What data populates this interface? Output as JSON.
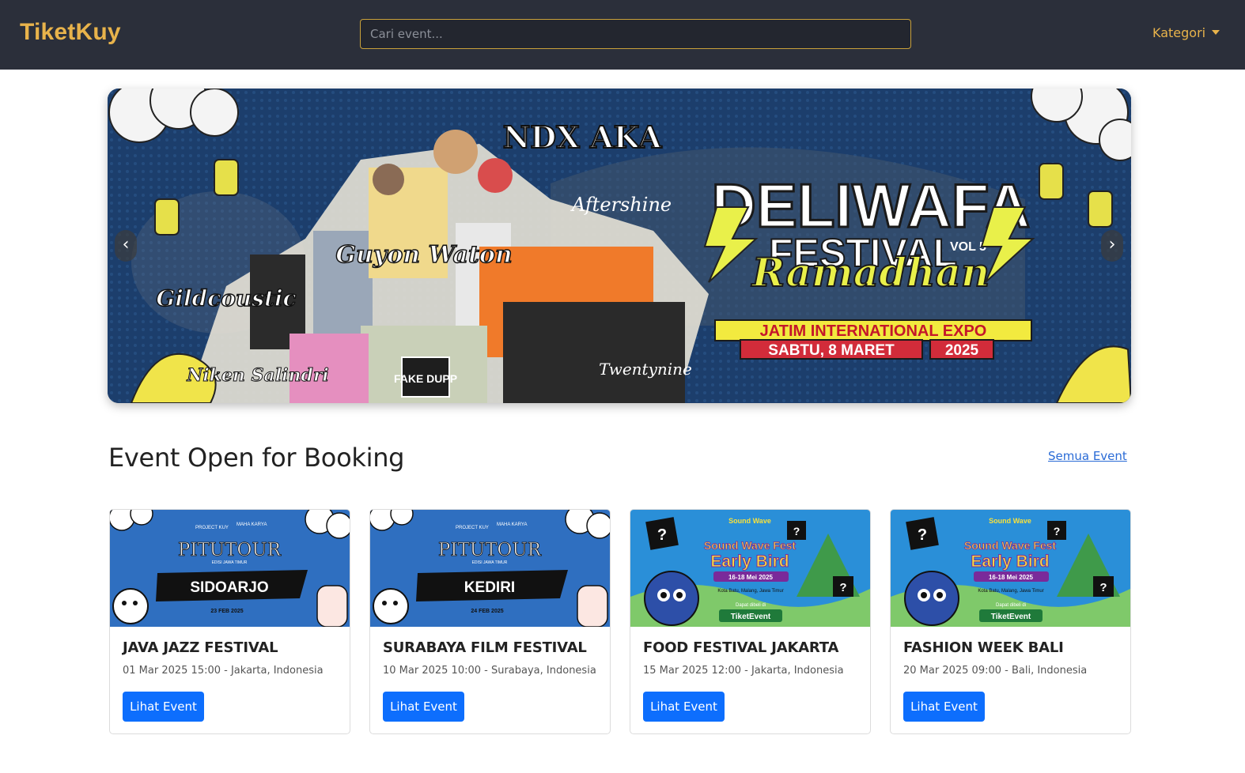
{
  "navbar": {
    "brand": "TiketKuy",
    "search_placeholder": "Cari event...",
    "category_label": "Kategori"
  },
  "carousel": {
    "banner": {
      "headline_1": "DELIWAFA",
      "headline_2": "FESTIVAL",
      "volume": "VOL 5",
      "subtitle": "Ramadhan",
      "venue": "JATIM INTERNATIONAL EXPO",
      "date": "SABTU, 8 MARET",
      "year": "2025",
      "lineup": [
        "NDX AKA",
        "Aftershine",
        "Guyon Waton",
        "Gildcoustic",
        "Niken Salindri",
        "FAKE DUPP",
        "Twentynine"
      ]
    },
    "prev_symbol": "‹",
    "next_symbol": "›"
  },
  "section": {
    "title": "Event Open for Booking",
    "all_link": "Semua Event"
  },
  "events": [
    {
      "title": "JAVA JAZZ FESTIVAL",
      "meta": "01 Mar 2025 15:00 - Jakarta, Indonesia",
      "button": "Lihat Event",
      "poster": {
        "headline": "PITUTOUR",
        "tagline": "EDISI JAWA TIMUR",
        "city": "SIDOARJO",
        "date": "23 FEB 2025",
        "org_1": "PROJECT KUY",
        "org_2": "MAHA KARYA"
      }
    },
    {
      "title": "SURABAYA FILM FESTIVAL",
      "meta": "10 Mar 2025 10:00 - Surabaya, Indonesia",
      "button": "Lihat Event",
      "poster": {
        "headline": "PITUTOUR",
        "tagline": "EDISI JAWA TIMUR",
        "city": "KEDIRI",
        "date": "24 FEB 2025",
        "org_1": "PROJECT KUY",
        "org_2": "MAHA KARYA"
      }
    },
    {
      "title": "FOOD FESTIVAL JAKARTA",
      "meta": "15 Mar 2025 12:00 - Jakarta, Indonesia",
      "button": "Lihat Event",
      "poster": {
        "brand": "Sound Wave",
        "headline": "Sound Wave Fest",
        "sub": "Early Bird",
        "dates": "16-18 Mei 2025",
        "location": "Kota Batu, Malang, Jawa Timur",
        "buy_note": "Dapat dibeli di",
        "seller": "TiketEvent"
      }
    },
    {
      "title": "FASHION WEEK BALI",
      "meta": "20 Mar 2025 09:00 - Bali, Indonesia",
      "button": "Lihat Event",
      "poster": {
        "brand": "Sound Wave",
        "headline": "Sound Wave Fest",
        "sub": "Early Bird",
        "dates": "16-18 Mei 2025",
        "location": "Kota Batu, Malang, Jawa Timur",
        "buy_note": "Dapat dibeli di",
        "seller": "TiketEvent"
      }
    }
  ]
}
